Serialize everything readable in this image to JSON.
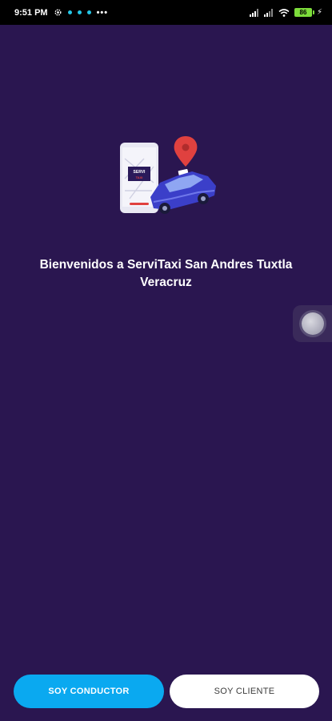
{
  "status_bar": {
    "time": "9:51 PM",
    "more": "•••",
    "battery": "86",
    "icons": [
      "settings-gear-icon",
      "notification-dot-icon",
      "notification-dot-icon",
      "notification-dot-icon",
      "signal-icon",
      "signal-icon",
      "wifi-icon",
      "battery-icon",
      "charging-bolt-icon"
    ]
  },
  "illustration": {
    "phone_screen_text_1": "SERVI",
    "phone_screen_text_2": "TAXI",
    "icons": [
      "phone-map-icon",
      "location-pin-icon",
      "taxi-car-icon"
    ],
    "colors": {
      "pin": "#e0413f",
      "car": "#3b3fc9",
      "phone": "#e9e9f3"
    }
  },
  "welcome": {
    "line1": "Bienvenidos a ServiTaxi San Andres Tuxtla",
    "line2": "Veracruz"
  },
  "buttons": {
    "driver_label": "SOY CONDUCTOR",
    "client_label": "SOY CLIENTE"
  },
  "colors": {
    "background": "#2a1650",
    "primary_button": "#0aa9f0",
    "secondary_button": "#ffffff"
  }
}
